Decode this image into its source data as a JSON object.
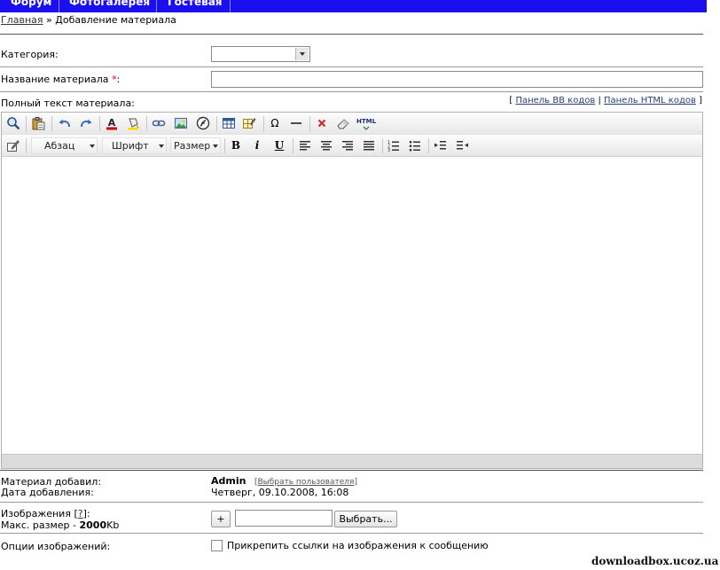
{
  "nav": {
    "items": [
      "Форум",
      "Фотогалерея",
      "Гостевая"
    ]
  },
  "breadcrumb": {
    "home": "Главная",
    "separator": "»",
    "current": "Добавление материала"
  },
  "form": {
    "category_label": "Категория:",
    "category_value": "",
    "title_label": "Название материала",
    "required_mark": "*",
    "colon": ":",
    "title_value": "",
    "fulltext_label": "Полный текст материала:",
    "panel_links": {
      "open": "[",
      "bb": "Панель BB кодов",
      "pipe": "|",
      "html": "Панель HTML кодов",
      "close": "]"
    }
  },
  "editor": {
    "dropdowns": {
      "paragraph": "Абзац",
      "font": "Шрифт",
      "size": "Размер"
    },
    "html_label": "HTML",
    "colors": {
      "text_color": "#d40000",
      "toolbar_bg": "#ececec"
    },
    "content": ""
  },
  "meta": {
    "added_by_label": "Материал добавил:",
    "added_by_value": "Admin",
    "choose_user": {
      "open": "[",
      "link": "Выбрать пользователя",
      "close": "]"
    },
    "date_label": "Дата добавления:",
    "date_value": "Четверг, 09.10.2008, 16:08"
  },
  "images": {
    "label_prefix": "Изображения [",
    "help_link": "?",
    "label_suffix": "]:",
    "max_size_prefix": "Макс. размер - ",
    "max_size_value": "2000",
    "max_size_unit": "Kb",
    "add_button": "+",
    "file_value": "",
    "browse_button": "Выбрать..."
  },
  "options": {
    "label": "Опции изображений:",
    "attach_links_label": "Прикрепить ссылки на изображения к сообщению",
    "attach_links_checked": false
  },
  "watermark": "downloadbox.ucoz.ua",
  "brand": {
    "nav_bg": "#1b0ff0"
  }
}
